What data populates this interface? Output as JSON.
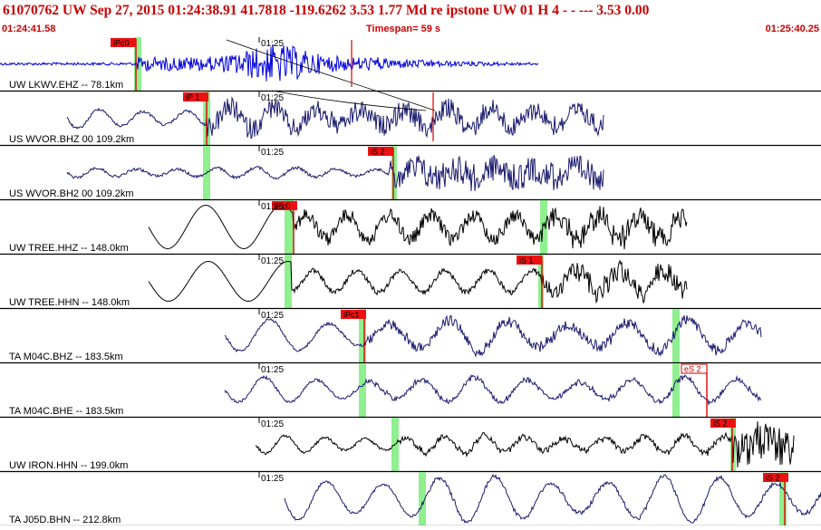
{
  "header": {
    "title": "61070762 UW Sep 27, 2015 01:24:38.91   41.7818 -119.6262  3.53 1.77 Md re    ipstone  UW 01 H     4   -  -  ---   3.53 0.00",
    "start_time": "01:24:41.58",
    "timespan": "Timespan=  59 s",
    "end_time": "01:25:40.25"
  },
  "colors": {
    "header_text": "#cc0000",
    "pick_flag": "#ee1111",
    "pick_line": "#dd0000",
    "green_band": "#8ff08f",
    "trace_blue": "#0000dd",
    "trace_navy": "#1a1a6e",
    "trace_black": "#000000"
  },
  "channels": [
    {
      "label": "UW LKWV.EHZ -- 78.1km",
      "tick": "01:25",
      "color": "#0000dd",
      "picks": [
        "iPc0"
      ]
    },
    {
      "label": "US WVOR.BHZ 00 109.2km",
      "tick": "01:25",
      "color": "#1a1a6e",
      "picks": [
        "iP 1"
      ]
    },
    {
      "label": "US WVOR.BH2 00 109.2km",
      "tick": "01:25",
      "color": "#1a1a6e",
      "picks": [
        "iS 2"
      ]
    },
    {
      "label": "UW TREE.HHZ -- 148.0km",
      "tick": "01:25",
      "color": "#000000",
      "picks": [
        "iPc0"
      ]
    },
    {
      "label": "UW TREE.HHN -- 148.0km",
      "tick": "01:25",
      "color": "#000000",
      "picks": [
        "iS 1"
      ]
    },
    {
      "label": "TA M04C.BHZ -- 183.5km",
      "tick": "01:25",
      "color": "#1a1a6e",
      "picks": [
        "iPc1"
      ]
    },
    {
      "label": "TA M04C.BHE -- 183.5km",
      "tick": "01:25",
      "color": "#1a1a6e",
      "picks": [
        "eS 2"
      ]
    },
    {
      "label": "UW IRON.HHN -- 199.0km",
      "tick": "01:25",
      "color": "#000000",
      "picks": [
        "iS 2"
      ]
    },
    {
      "label": "TA J05D.BHN -- 212.8km",
      "tick": "01:25",
      "color": "#1a1a6e",
      "picks": [
        "iS 2"
      ]
    }
  ]
}
